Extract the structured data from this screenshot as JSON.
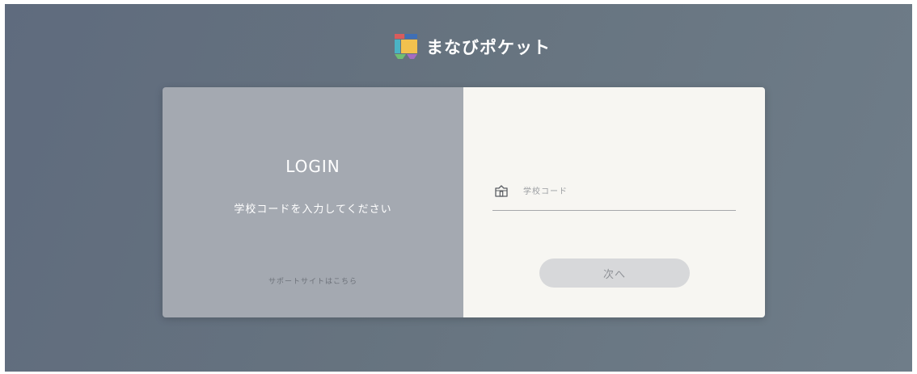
{
  "brand": {
    "name": "まなびポケット",
    "icon": "manabi-pocket-logo"
  },
  "login": {
    "title": "LOGIN",
    "subtitle": "学校コードを入力してください",
    "support_link": "サポートサイトはこちら"
  },
  "form": {
    "school_code": {
      "icon": "school-icon",
      "placeholder": "学校コード",
      "value": ""
    },
    "next_button": "次へ"
  },
  "colors": {
    "left_panel": "#a4a9b1",
    "right_panel": "#f7f6f2",
    "button_disabled": "#d7d8da"
  }
}
